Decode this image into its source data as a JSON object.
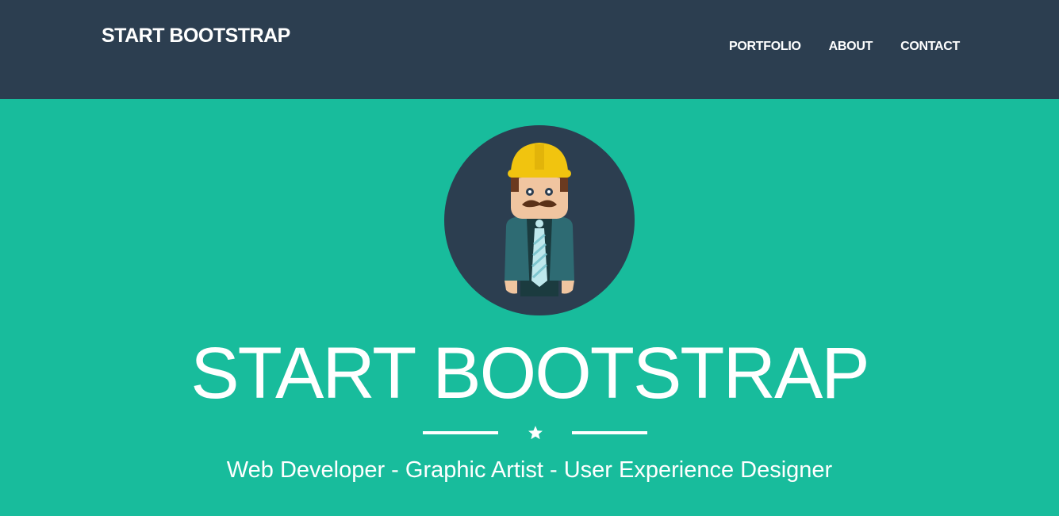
{
  "navbar": {
    "brand": "START BOOTSTRAP",
    "links": [
      {
        "label": "PORTFOLIO"
      },
      {
        "label": "ABOUT"
      },
      {
        "label": "CONTACT"
      }
    ]
  },
  "hero": {
    "avatar_icon": "construction-worker-avatar",
    "title": "START BOOTSTRAP",
    "divider_icon": "star-icon",
    "subtitle": "Web Developer - Graphic Artist - User Experience Designer"
  },
  "colors": {
    "navbar_bg": "#2c3e50",
    "hero_bg": "#18bc9c",
    "text": "#ffffff",
    "helmet": "#f1c40f"
  }
}
